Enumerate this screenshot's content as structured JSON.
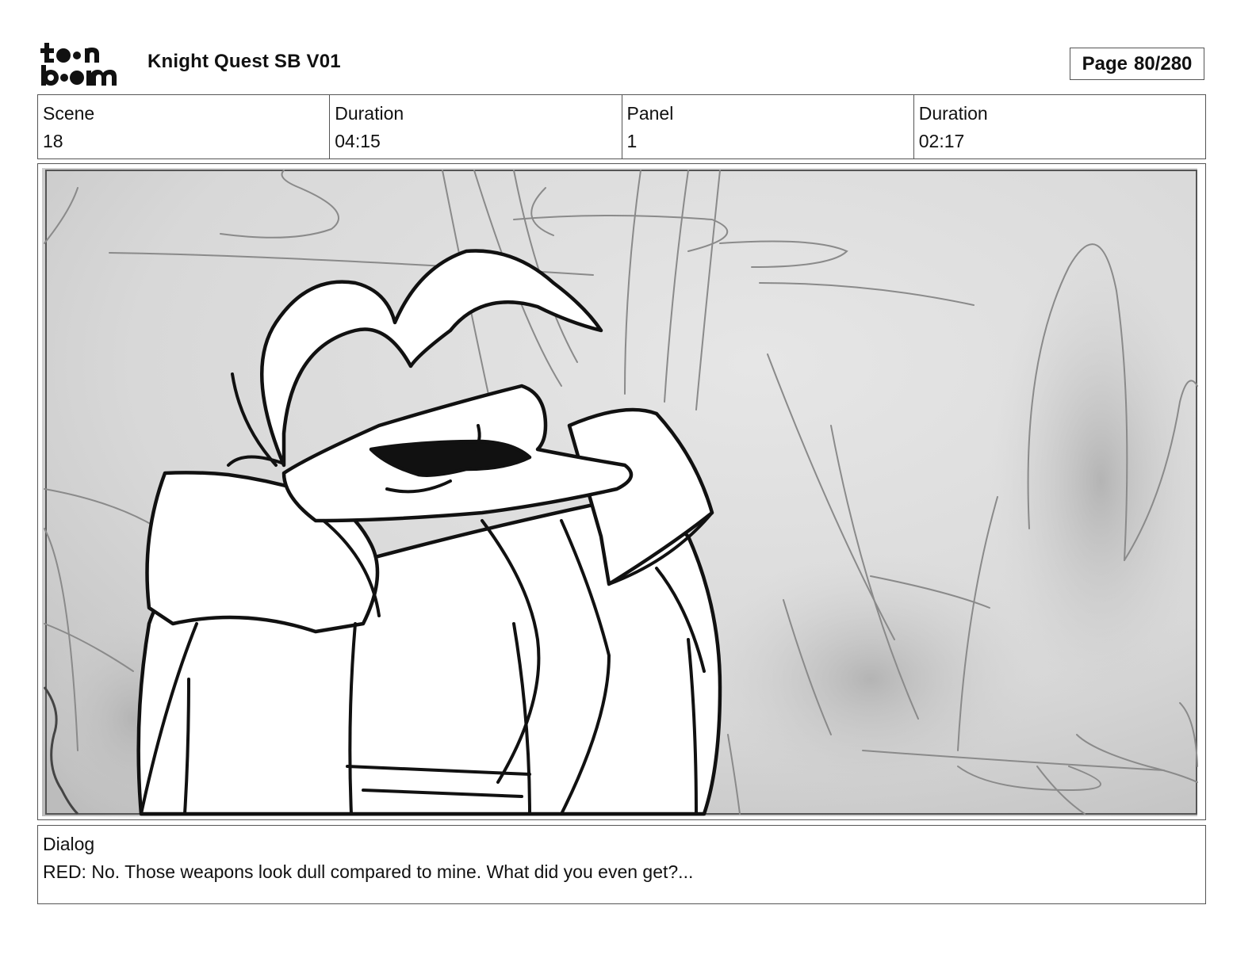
{
  "header": {
    "logo_text": "toonboom",
    "project_title": "Knight Quest SB V01",
    "page_label": "Page",
    "page_value": "80/280"
  },
  "info": {
    "scene_label": "Scene",
    "scene_value": "18",
    "scene_duration_label": "Duration",
    "scene_duration_value": "04:15",
    "panel_label": "Panel",
    "panel_value": "1",
    "panel_duration_label": "Duration",
    "panel_duration_value": "02:17"
  },
  "panel_image": {
    "description_icon": "storyboard-sketch-knight-with-sunglasses"
  },
  "dialog": {
    "label": "Dialog",
    "text": "RED: No. Those weapons look dull compared to mine. What did you even get?..."
  }
}
